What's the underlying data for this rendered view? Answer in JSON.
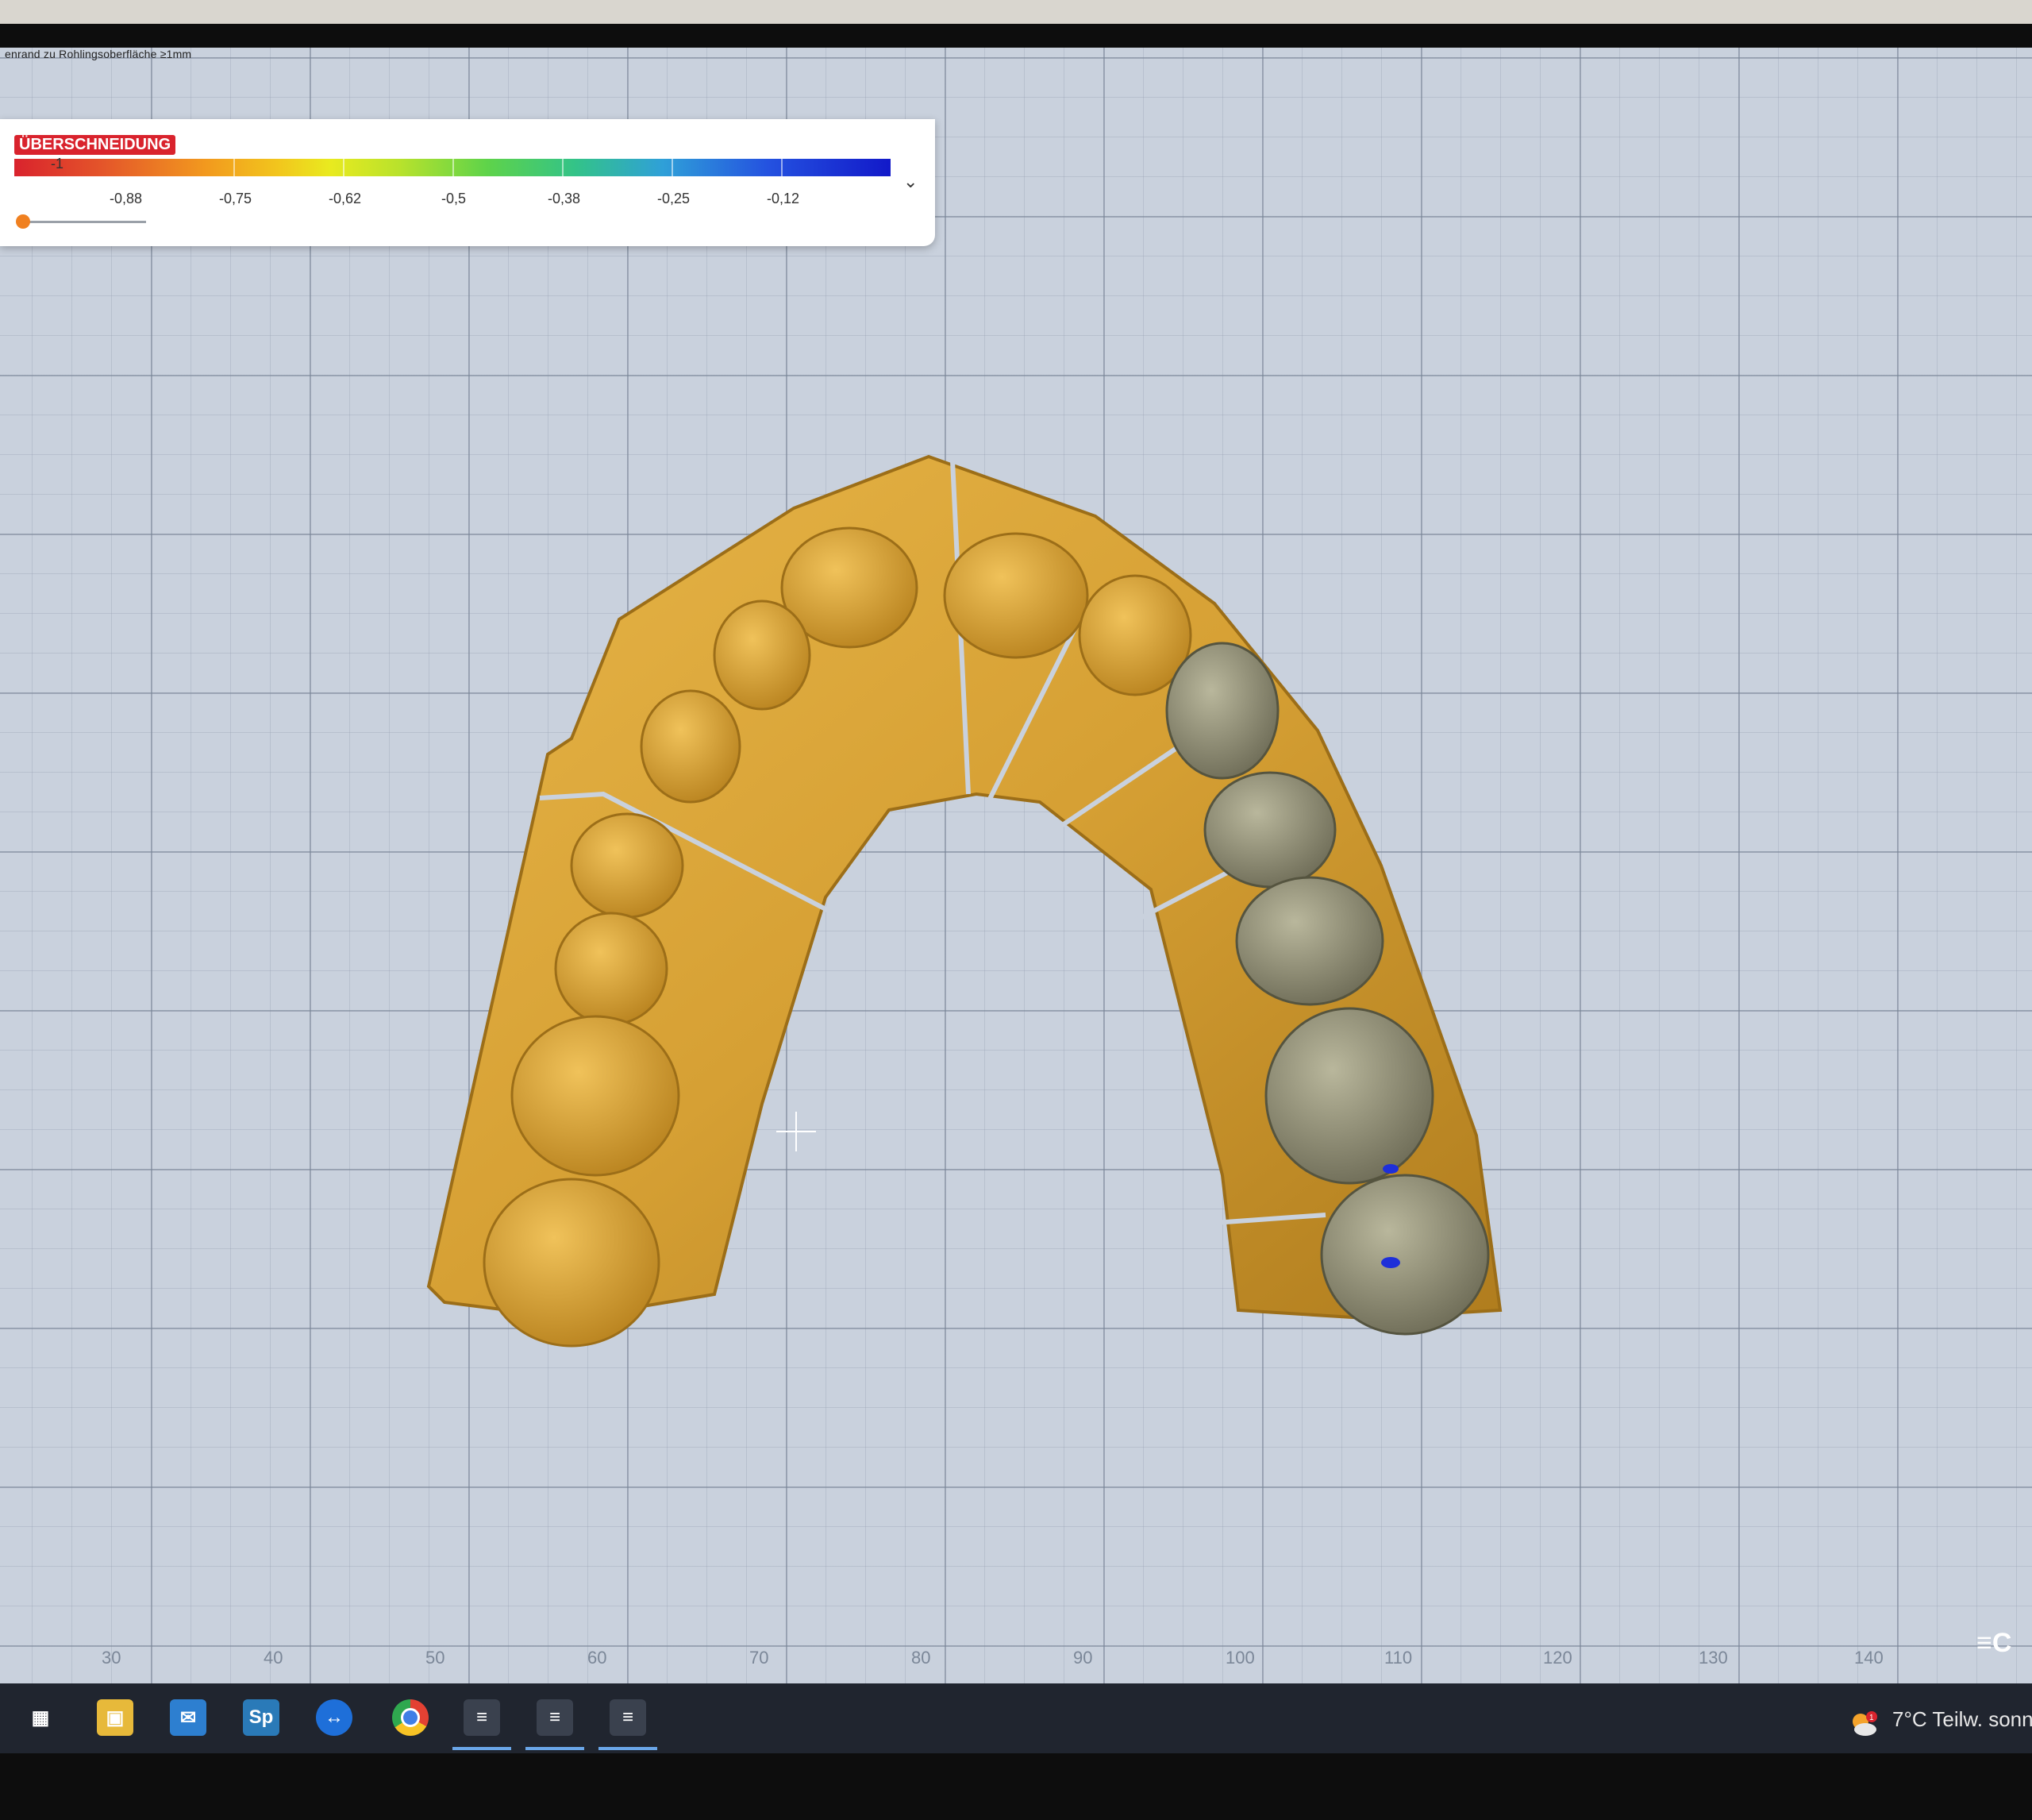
{
  "window": {
    "top_note": "enrand zu Rohlingsoberfläche ≥1mm"
  },
  "legend": {
    "title": "ÜBERSCHNEIDUNG",
    "ticks": [
      "-1",
      "-0,88",
      "-0,75",
      "-0,62",
      "-0,5",
      "-0,38",
      "-0,25",
      "-0,12"
    ],
    "colors": [
      "#d9232d",
      "#f29a1e",
      "#e9ea1f",
      "#5ed34a",
      "#2fa0d8",
      "#1219c9"
    ],
    "slider_value": -1
  },
  "ruler": {
    "labels": [
      "30",
      "40",
      "50",
      "60",
      "70",
      "80",
      "90",
      "100",
      "110",
      "120",
      "130",
      "140"
    ]
  },
  "viewport": {
    "model_color": "#d6a034",
    "crown_color": "#8e8c72",
    "background": "#c9d1dd"
  },
  "taskbar": {
    "icons": [
      "task-view-icon",
      "file-explorer-icon",
      "mail-icon",
      "sp-app-icon",
      "teamviewer-icon",
      "chrome-icon",
      "cad-app-icon",
      "cad-app-icon",
      "cad-app-icon"
    ],
    "sp_label": "Sp",
    "weather": "7°C  Teilw. sonn",
    "notification_count": "1"
  }
}
